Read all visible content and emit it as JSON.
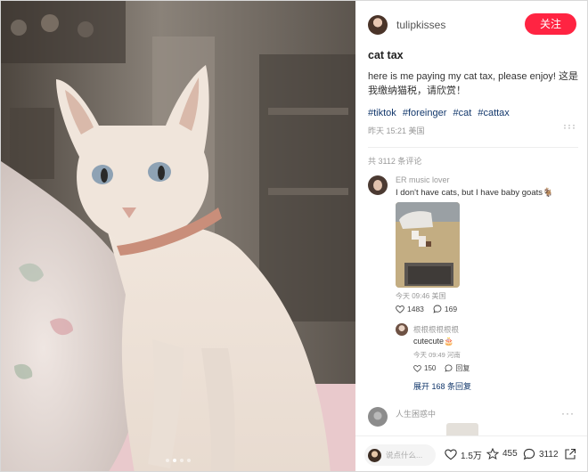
{
  "author": {
    "name": "tulipkisses",
    "follow_label": "关注"
  },
  "note": {
    "title": "cat tax",
    "description": "here is me paying my cat tax, please enjoy! 这是我缴纳猫税，请欣赏！",
    "tags": [
      "#tiktok",
      "#foreinger",
      "#cat",
      "#cattax"
    ],
    "meta": "昨天 15:21 美国",
    "more": "···"
  },
  "comments_header": "共 3112 条评论",
  "comments": [
    {
      "name": "ER music lover",
      "text": "I don't have cats, but I have baby goats🐐",
      "meta": "今天 09:46 美国",
      "likes": "1483",
      "replies": "169",
      "more": "···",
      "reply": {
        "name": "根根根根根根",
        "text": "cutecute🎂",
        "meta": "今天 09:49 河南",
        "likes": "150",
        "reply_label": "回复",
        "expand_label": "展开 168 条回复"
      }
    },
    {
      "name": "人生困惑中",
      "more": "···"
    }
  ],
  "bottom_bar": {
    "placeholder": "说点什么...",
    "likes": "1.5万",
    "collects": "455",
    "comments": "3112"
  },
  "colors": {
    "accent": "#ff2442",
    "tag": "#13386c"
  },
  "carousel": {
    "count": 4,
    "active": 1
  }
}
